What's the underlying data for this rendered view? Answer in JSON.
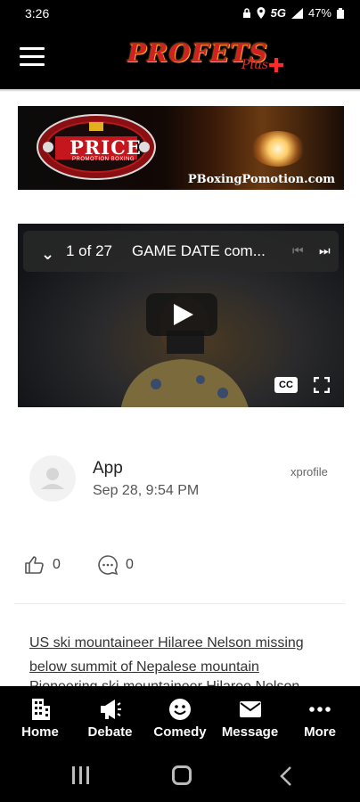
{
  "status_bar": {
    "time": "3:26",
    "network": "5G",
    "battery": "47%",
    "icons": [
      "lock-icon",
      "location-icon",
      "signal-icon",
      "battery-icon"
    ]
  },
  "app_bar": {
    "menu_icon": "hamburger-menu-icon",
    "logo_text": "PROFETS",
    "logo_suffix": "Plus"
  },
  "banner": {
    "brand": "PRICE",
    "brand_sub": "PROMOTION BOXING",
    "url": "PBoxingPomotion.com"
  },
  "video": {
    "count": "1 of 27",
    "title": "GAME DATE com...",
    "icons": [
      "chevron-down-icon",
      "skip-previous-icon",
      "skip-next-icon",
      "play-icon",
      "closed-captions-icon",
      "fullscreen-icon"
    ],
    "cc_label": "CC"
  },
  "post": {
    "author": "App",
    "date": "Sep 28, 9:54 PM",
    "source": "xprofile",
    "likes": "0",
    "comments": "0",
    "link_text": "US ski mountaineer Hilaree Nelson missing below summit of Nepalese mountain",
    "preview_text": "Pioneering ski mountaineer Hilaree Nelson"
  },
  "bottom_nav": {
    "items": [
      {
        "label": "Home",
        "icon": "building-icon"
      },
      {
        "label": "Debate",
        "icon": "megaphone-icon"
      },
      {
        "label": "Comedy",
        "icon": "smiley-icon"
      },
      {
        "label": "Message",
        "icon": "envelope-icon"
      },
      {
        "label": "More",
        "icon": "more-dots-icon"
      }
    ]
  },
  "system_nav": {
    "icons": [
      "recents-icon",
      "home-icon",
      "back-icon"
    ]
  },
  "colors": {
    "bar_background": "#000000",
    "logo_red": "#d22020",
    "text_primary": "#222222",
    "text_secondary": "#555555"
  }
}
